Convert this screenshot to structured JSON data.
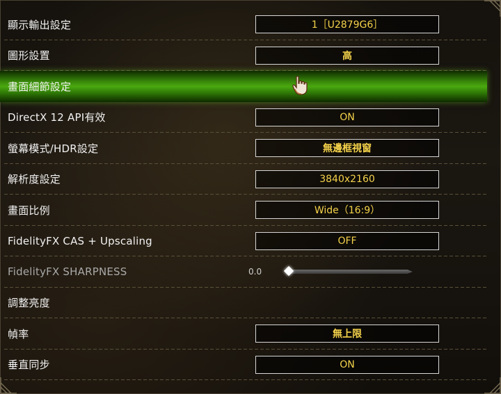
{
  "rows": [
    {
      "label": "顯示輸出設定",
      "value": "1［U2879G6］"
    },
    {
      "label": "圖形設置",
      "value": "高"
    },
    {
      "label": "畫面細節設定",
      "value": ""
    },
    {
      "label": "DirectX 12 API有效",
      "value": "ON"
    },
    {
      "label": "螢幕模式/HDR設定",
      "value": "無邊框視窗"
    },
    {
      "label": "解析度設定",
      "value": "3840x2160"
    },
    {
      "label": "畫面比例",
      "value": "Wide（16:9）"
    },
    {
      "label": "FidelityFX CAS + Upscaling",
      "value": "OFF"
    },
    {
      "label": "FidelityFX SHARPNESS",
      "value": "0.0"
    },
    {
      "label": "調整亮度",
      "value": ""
    },
    {
      "label": "幀率",
      "value": "無上限"
    },
    {
      "label": "垂直同步",
      "value": "ON"
    }
  ],
  "sharpness": {
    "level": 0.0
  },
  "colors": {
    "value_text": "#f4d24a",
    "selected_row": "#4aa80f"
  },
  "icons": {
    "cursor": "hand-pointer-icon",
    "corner": "ornament-corner-icon"
  }
}
